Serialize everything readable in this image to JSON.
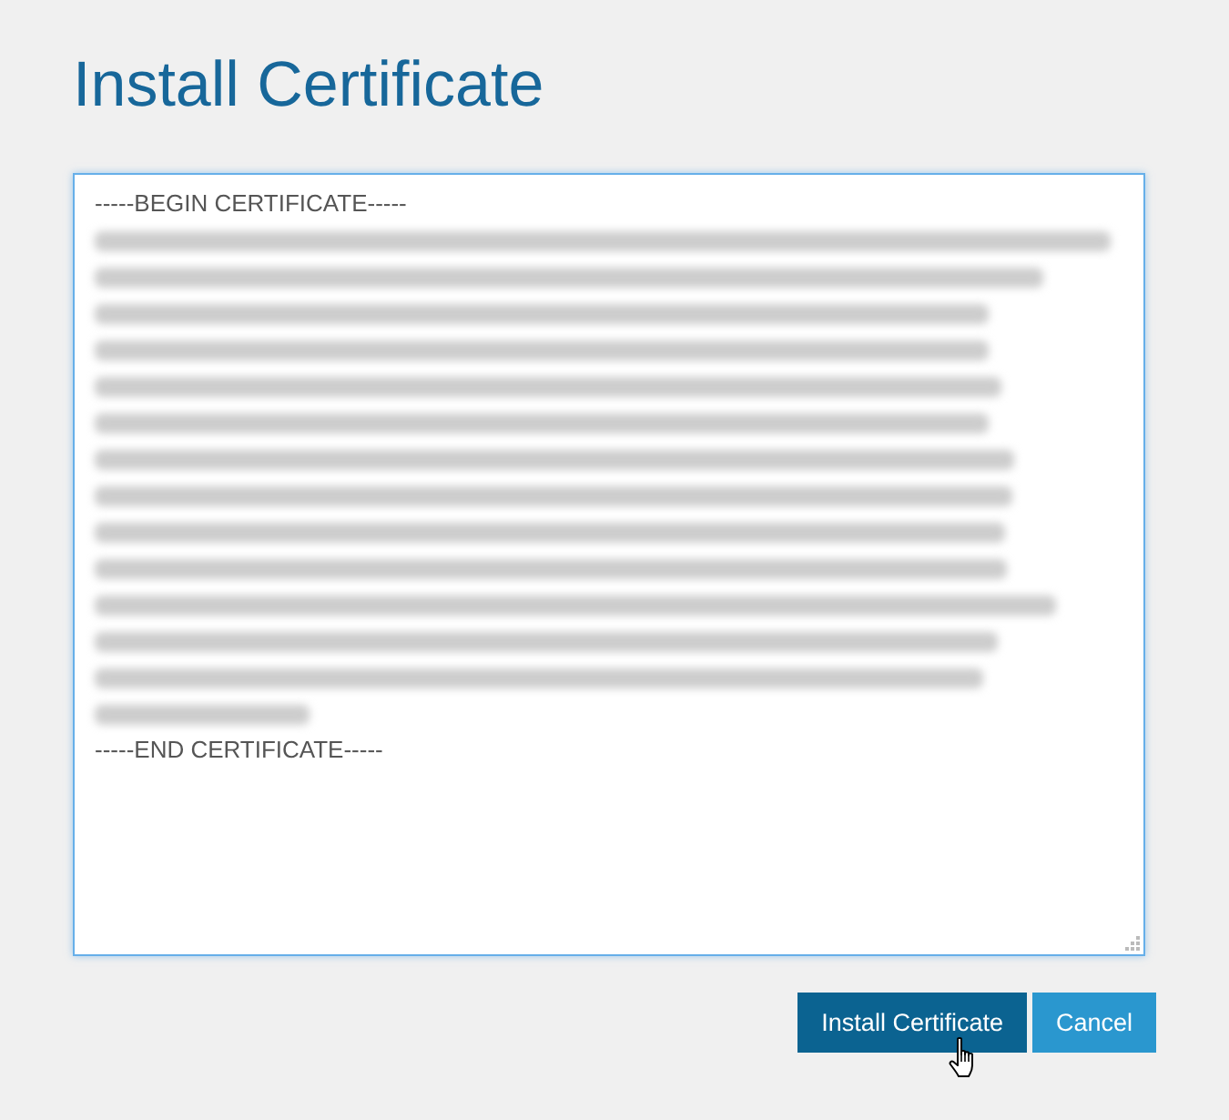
{
  "title": "Install Certificate",
  "certificate": {
    "focused": true,
    "begin_line": "-----BEGIN CERTIFICATE-----",
    "end_line": "-----END CERTIFICATE-----"
  },
  "buttons": [
    {
      "label": "Install Certificate",
      "kind": "primary"
    },
    {
      "label": "Cancel",
      "kind": "secondary"
    }
  ]
}
